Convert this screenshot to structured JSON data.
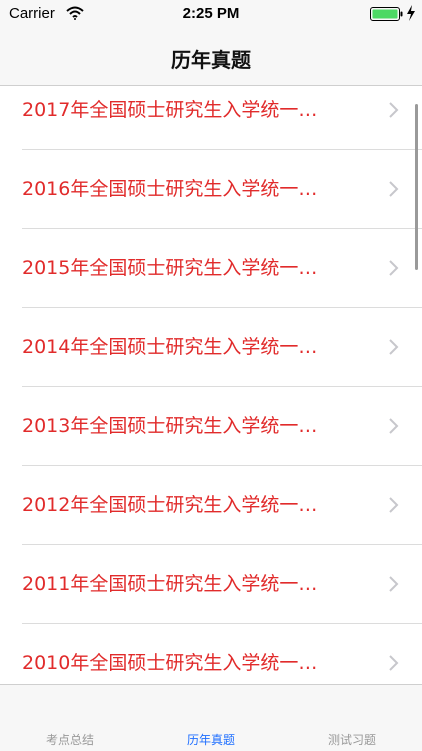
{
  "status_bar": {
    "carrier": "Carrier",
    "time": "2:25 PM",
    "icons": [
      "wifi-icon",
      "battery-icon",
      "charging-icon"
    ]
  },
  "nav": {
    "title": "历年真题"
  },
  "list": {
    "items": [
      {
        "label": "2017年全国硕士研究生入学统一…"
      },
      {
        "label": "2016年全国硕士研究生入学统一…"
      },
      {
        "label": "2015年全国硕士研究生入学统一…"
      },
      {
        "label": "2014年全国硕士研究生入学统一…"
      },
      {
        "label": "2013年全国硕士研究生入学统一…"
      },
      {
        "label": "2012年全国硕士研究生入学统一…"
      },
      {
        "label": "2011年全国硕士研究生入学统一…"
      },
      {
        "label": "2010年全国硕士研究生入学统一…"
      }
    ]
  },
  "tabs": [
    {
      "label": "考点总结",
      "active": false
    },
    {
      "label": "历年真题",
      "active": true
    },
    {
      "label": "测试习题",
      "active": false
    }
  ],
  "colors": {
    "accent": "#1f6fff",
    "row_text": "#e12b2b",
    "bar_bg": "#f7f7f7",
    "battery": "#4cd964"
  }
}
